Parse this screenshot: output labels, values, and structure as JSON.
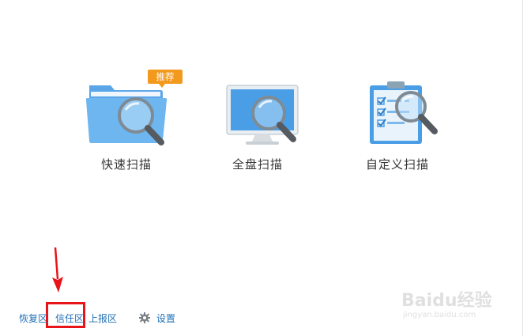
{
  "scan_options": [
    {
      "label": "快速扫描",
      "badge": "推荐",
      "icon": "folder-magnifier-icon"
    },
    {
      "label": "全盘扫描",
      "icon": "monitor-magnifier-icon"
    },
    {
      "label": "自定义扫描",
      "icon": "checklist-magnifier-icon"
    }
  ],
  "bottom_links": {
    "recovery": "恢复区",
    "trust": "信任区",
    "report": "上报区",
    "settings": "设置"
  },
  "watermark": {
    "brand": "Baidu经验",
    "site": "jingyan.baidu.com"
  },
  "colors": {
    "link": "#1f6fb5",
    "badge": "#f39a1e",
    "highlight": "#e8141a",
    "icon_blue": "#4a9ee6"
  }
}
